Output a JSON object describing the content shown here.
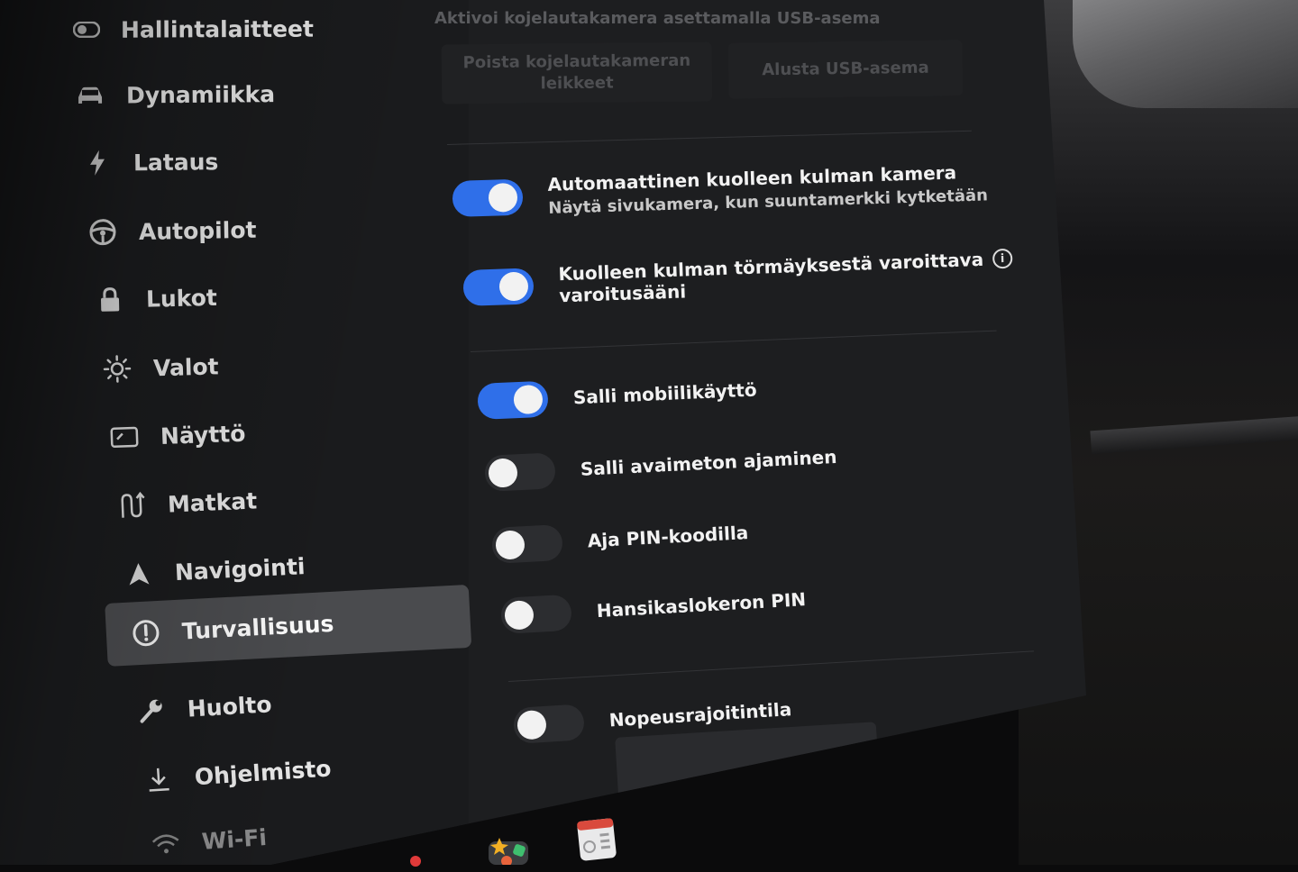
{
  "sidebar": {
    "items": [
      {
        "label": "Hallintalaitteet",
        "icon": "toggle-icon"
      },
      {
        "label": "Dynamiikka",
        "icon": "car-icon"
      },
      {
        "label": "Lataus",
        "icon": "bolt-icon"
      },
      {
        "label": "Autopilot",
        "icon": "steering-wheel-icon"
      },
      {
        "label": "Lukot",
        "icon": "lock-icon"
      },
      {
        "label": "Valot",
        "icon": "sun-icon"
      },
      {
        "label": "Näyttö",
        "icon": "display-icon"
      },
      {
        "label": "Matkat",
        "icon": "trips-icon"
      },
      {
        "label": "Navigointi",
        "icon": "navigation-arrow-icon"
      },
      {
        "label": "Turvallisuus",
        "icon": "alert-circle-icon",
        "active": true
      },
      {
        "label": "Huolto",
        "icon": "wrench-icon"
      },
      {
        "label": "Ohjelmisto",
        "icon": "download-icon"
      },
      {
        "label": "Wi-Fi",
        "icon": "wifi-icon"
      }
    ]
  },
  "dashcam": {
    "hint": "Aktivoi kojelautakamera asettamalla USB-asema",
    "delete_clips_label": "Poista kojelautakameran leikkeet",
    "format_usb_label": "Alusta USB-asema"
  },
  "settings": {
    "blind_spot_camera": {
      "label": "Automaattinen kuolleen kulman kamera",
      "sublabel": "Näytä sivukamera, kun suuntamerkki kytketään",
      "on": true
    },
    "blind_spot_chime": {
      "label": "Kuolleen kulman törmäyksestä varoittava",
      "label2": "varoitusääni",
      "on": true
    },
    "mobile_access": {
      "label": "Salli mobiilikäyttö",
      "on": true
    },
    "keyless_driving": {
      "label": "Salli avaimeton ajaminen",
      "on": false
    },
    "pin_to_drive": {
      "label": "Aja PIN-koodilla",
      "on": false
    },
    "glovebox_pin": {
      "label": "Hansikaslokeron PIN",
      "on": false
    },
    "speed_limit_mode": {
      "label": "Nopeusrajoitintila",
      "on": false
    }
  },
  "colors": {
    "accent": "#2f6fe9",
    "active_nav": "#4a4b4e",
    "background": "#1d1e20"
  },
  "taskbar": {
    "icons": [
      "back-chevron-icon",
      "mute-icon",
      "forward-chevron-icon",
      "toybox-icon",
      "calendar-icon"
    ]
  }
}
